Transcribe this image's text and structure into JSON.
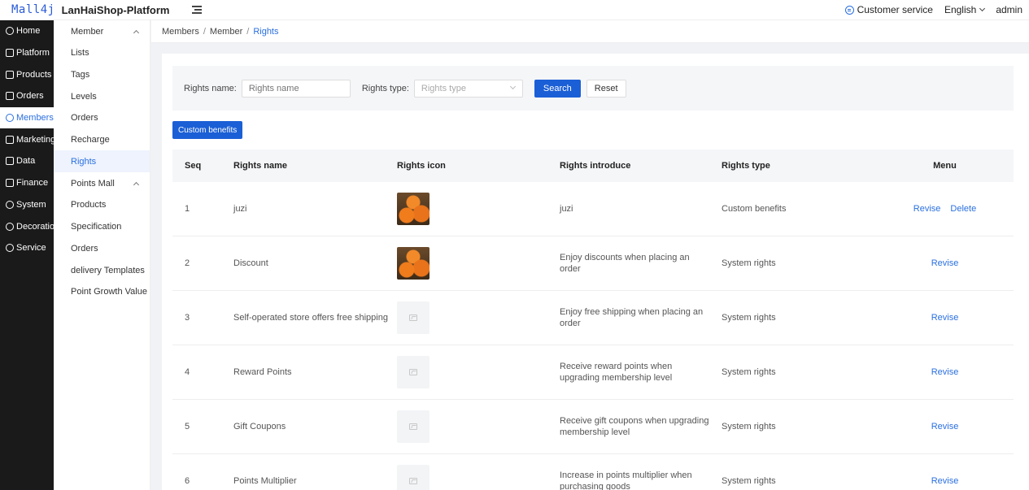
{
  "header": {
    "logo": "Mall4j",
    "platform": "LanHaiShop-Platform",
    "customer_service": "Customer service",
    "language": "English",
    "user": "admin"
  },
  "nav": {
    "items": [
      {
        "label": "Home",
        "icon": "home-icon"
      },
      {
        "label": "Platform",
        "icon": "platform-icon"
      },
      {
        "label": "Products",
        "icon": "products-icon"
      },
      {
        "label": "Orders",
        "icon": "orders-icon"
      },
      {
        "label": "Members",
        "icon": "members-icon"
      },
      {
        "label": "Marketing",
        "icon": "marketing-icon"
      },
      {
        "label": "Data",
        "icon": "data-icon"
      },
      {
        "label": "Finance",
        "icon": "finance-icon"
      },
      {
        "label": "System",
        "icon": "system-icon"
      },
      {
        "label": "Decoration",
        "icon": "decoration-icon"
      },
      {
        "label": "Service",
        "icon": "service-icon"
      }
    ],
    "active": "Members"
  },
  "submenu": {
    "group1": "Member",
    "group1_items": [
      "Lists",
      "Tags",
      "Levels",
      "Orders",
      "Recharge",
      "Rights"
    ],
    "group2": "Points Mall",
    "group2_items": [
      "Products",
      "Specification",
      "Orders",
      "delivery Templates",
      "Point Growth Value"
    ],
    "active": "Rights"
  },
  "breadcrumb": [
    "Members",
    "Member",
    "Rights"
  ],
  "filter": {
    "name_label": "Rights name:",
    "name_placeholder": "Rights name",
    "type_label": "Rights type:",
    "type_placeholder": "Rights type",
    "search": "Search",
    "reset": "Reset"
  },
  "add_button": "Custom benefits",
  "table": {
    "headers": [
      "Seq",
      "Rights name",
      "Rights icon",
      "Rights introduce",
      "Rights type",
      "Menu"
    ],
    "rows": [
      {
        "seq": "1",
        "name": "juzi",
        "icon": "orange",
        "intro": "juzi",
        "type": "Custom benefits",
        "revise": "Revise",
        "delete": "Delete"
      },
      {
        "seq": "2",
        "name": "Discount",
        "icon": "orange",
        "intro": "Enjoy discounts when placing an order",
        "type": "System rights",
        "revise": "Revise"
      },
      {
        "seq": "3",
        "name": "Self-operated store offers free shipping",
        "icon": "placeholder",
        "intro": "Enjoy free shipping when placing an order",
        "type": "System rights",
        "revise": "Revise"
      },
      {
        "seq": "4",
        "name": "Reward Points",
        "icon": "placeholder",
        "intro": "Receive reward points when upgrading membership level",
        "type": "System rights",
        "revise": "Revise"
      },
      {
        "seq": "5",
        "name": "Gift Coupons",
        "icon": "placeholder",
        "intro": "Receive gift coupons when upgrading membership level",
        "type": "System rights",
        "revise": "Revise"
      },
      {
        "seq": "6",
        "name": "Points Multiplier",
        "icon": "placeholder",
        "intro": "Increase in points multiplier when purchasing goods",
        "type": "System rights",
        "revise": "Revise"
      }
    ]
  },
  "colors": {
    "primary": "#1a5fd6",
    "link": "#2a6fe0",
    "nav_bg": "#1a1a1a"
  }
}
